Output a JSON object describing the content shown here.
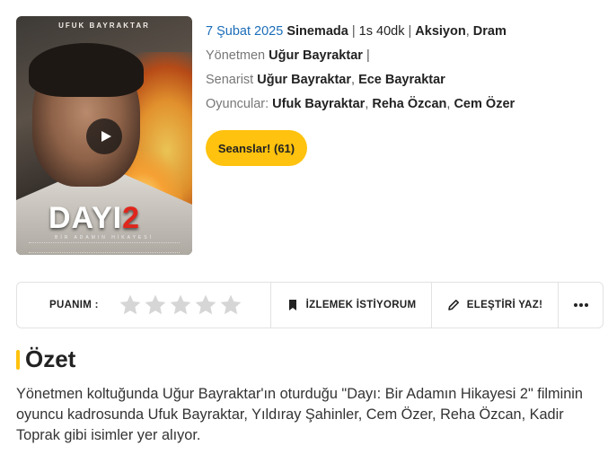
{
  "poster": {
    "actor_name": "UFUK BAYRAKTAR",
    "title_text": "DAYI",
    "title_number": "2",
    "subtitle": "BİR ADAMIN HİKAYESİ",
    "play_icon": "play-icon"
  },
  "info": {
    "date": "7 Şubat 2025",
    "release_status": "Sinemada",
    "duration": "1s 40dk",
    "genre_1": "Aksiyon",
    "genre_2": "Dram",
    "director_label": "Yönetmen",
    "director": "Uğur Bayraktar",
    "writer_label": "Senarist",
    "writer_1": "Uğur Bayraktar",
    "writer_2": "Ece Bayraktar",
    "cast_label": "Oyuncular:",
    "cast_1": "Ufuk Bayraktar",
    "cast_2": "Reha Özcan",
    "cast_3": "Cem Özer"
  },
  "sessions_button": "Seanslar! (61)",
  "action_bar": {
    "rating_label": "PUANIM :",
    "rating_value": 0,
    "rating_max": 5,
    "watchlist_label": "İZLEMEK İSTİYORUM",
    "watchlist_icon": "bookmark-icon",
    "review_label": "ELEŞTİRİ YAZ!",
    "review_icon": "pencil-icon",
    "more_icon": "more-icon"
  },
  "summary": {
    "heading": "Özet",
    "text": "Yönetmen koltuğunda Uğur Bayraktar'ın oturduğu \"Dayı: Bir Adamın Hikayesi 2\" filminin oyuncu kadrosunda Ufuk Bayraktar, Yıldıray Şahinler, Cem Özer, Reha Özcan, Kadir Toprak gibi isimler yer alıyor."
  },
  "colors": {
    "accent": "#ffc20e",
    "link_blue": "#1b6db8",
    "star_empty": "#d6d6d6"
  }
}
